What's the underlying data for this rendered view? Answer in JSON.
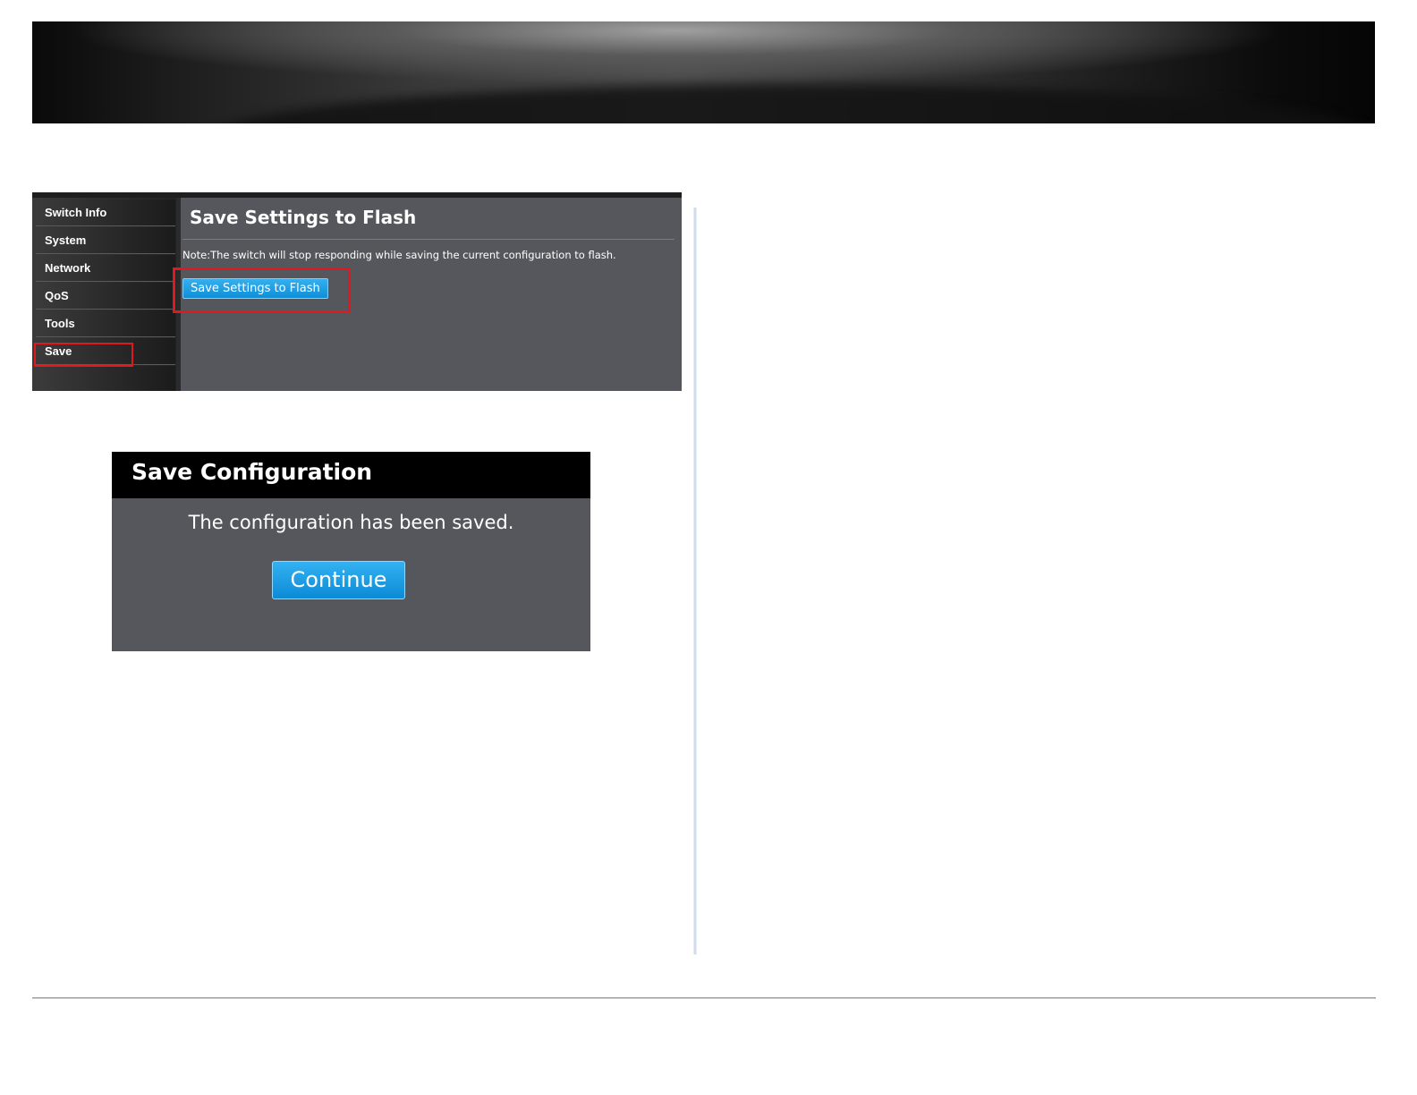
{
  "switch_ui": {
    "nav_items": [
      {
        "label": "Switch Info",
        "selected": false
      },
      {
        "label": "System",
        "selected": false
      },
      {
        "label": "Network",
        "selected": false
      },
      {
        "label": "QoS",
        "selected": false
      },
      {
        "label": "Tools",
        "selected": false
      },
      {
        "label": "Save",
        "selected": true
      }
    ],
    "page_title": "Save Settings to Flash",
    "note": "Note:The switch will stop responding while saving the current configuration to flash.",
    "save_button_label": "Save Settings to Flash",
    "highlight_color": "#e0191f"
  },
  "dialog": {
    "title": "Save Configuration",
    "message": "The configuration has been saved.",
    "continue_label": "Continue"
  },
  "colors": {
    "panel_bg": "#55575c",
    "button_blue": "#1a9be0",
    "footer_rule": "#3b8ad0"
  }
}
